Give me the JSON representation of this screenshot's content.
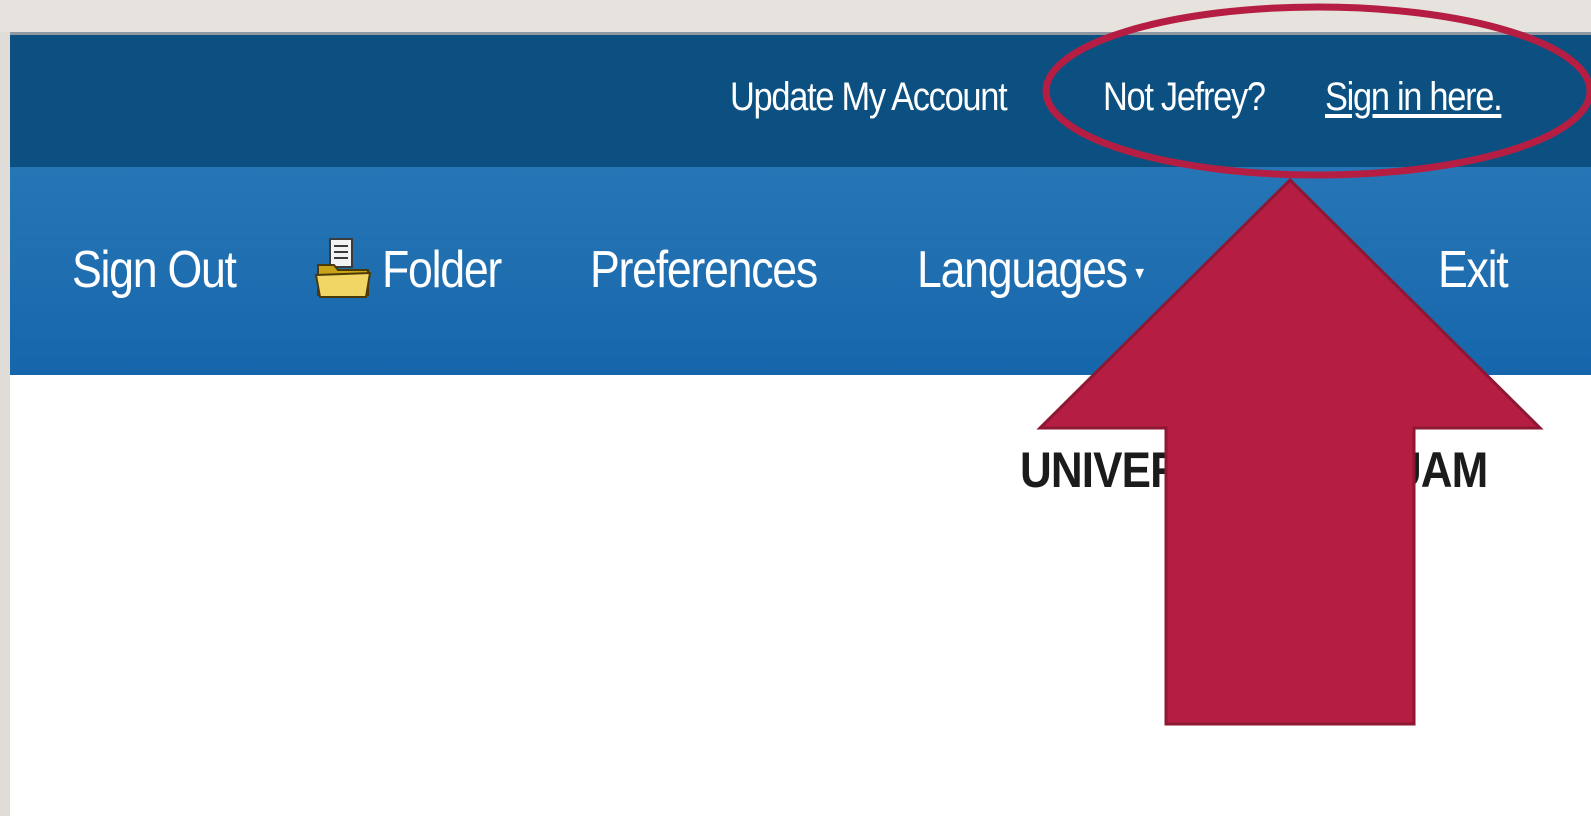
{
  "header": {
    "update_account": "Update My Account",
    "not_user": "Not Jefrey?",
    "sign_in": "Sign in here."
  },
  "nav": {
    "sign_out": "Sign Out",
    "folder": "Folder",
    "preferences": "Preferences",
    "languages": "Languages",
    "exit": "Exit",
    "dropdown_caret": "▾"
  },
  "main": {
    "institution_title": "UNIVERSITY OF GUAM"
  },
  "icons": {
    "folder": "folder-icon",
    "dropdown": "chevron-down-icon"
  },
  "colors": {
    "account_bar": "#0b5081",
    "nav_bar_top": "#2676b7",
    "nav_bar_bottom": "#1566ac",
    "annotation": "#b51e42"
  }
}
